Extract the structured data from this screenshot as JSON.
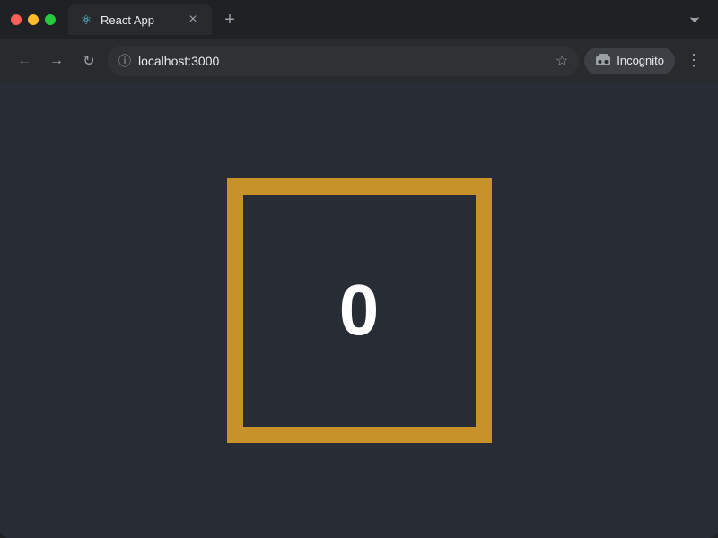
{
  "browser": {
    "tab": {
      "favicon": "⚛",
      "title": "React App",
      "close_label": "×"
    },
    "new_tab_label": "+",
    "overflow_label": "❯",
    "toolbar": {
      "back_label": "←",
      "forward_label": "→",
      "reload_label": "↻",
      "info_label": "ⓘ",
      "url": "localhost:3000",
      "star_label": "☆",
      "incognito_icon": "🕵",
      "incognito_label": "Incognito",
      "menu_label": "⋮"
    }
  },
  "page": {
    "counter_value": "0",
    "box_border_color": "#c8922a"
  }
}
